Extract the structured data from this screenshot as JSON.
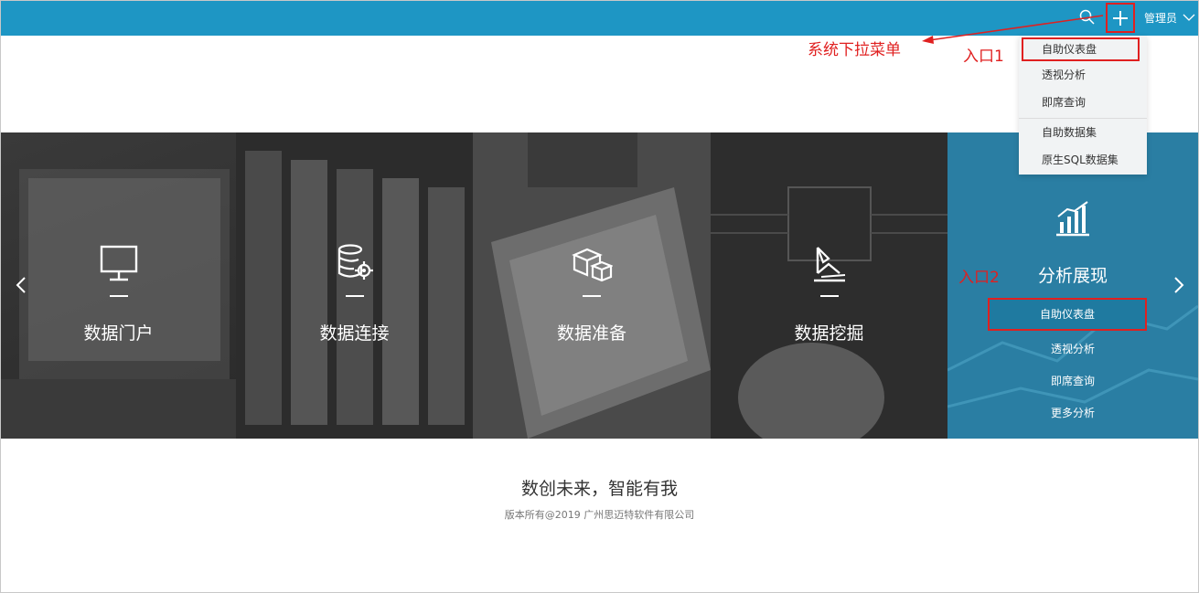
{
  "header": {
    "admin_label": "管理员"
  },
  "dropdown": {
    "items": [
      "自助仪表盘",
      "透视分析",
      "即席查询",
      "自助数据集",
      "原生SQL数据集"
    ]
  },
  "annotations": {
    "dropdown_label": "系统下拉菜单",
    "entry1": "入口1",
    "entry2": "入口2"
  },
  "banner": {
    "panels": [
      {
        "title": "数据门户",
        "icon": "monitor-icon"
      },
      {
        "title": "数据连接",
        "icon": "database-gear-icon"
      },
      {
        "title": "数据准备",
        "icon": "cubes-icon"
      },
      {
        "title": "数据挖掘",
        "icon": "mining-icon"
      },
      {
        "title": "分析展现",
        "icon": "bar-chart-icon"
      }
    ],
    "analysis_items": [
      "自助仪表盘",
      "透视分析",
      "即席查询",
      "更多分析"
    ]
  },
  "footer": {
    "slogan": "数创未来，智能有我",
    "copyright": "版本所有@2019 广州思迈特软件有限公司"
  },
  "colors": {
    "topbar": "#1e96c4",
    "annotation": "#e02020",
    "analysis_panel": "#2a7ea3"
  }
}
